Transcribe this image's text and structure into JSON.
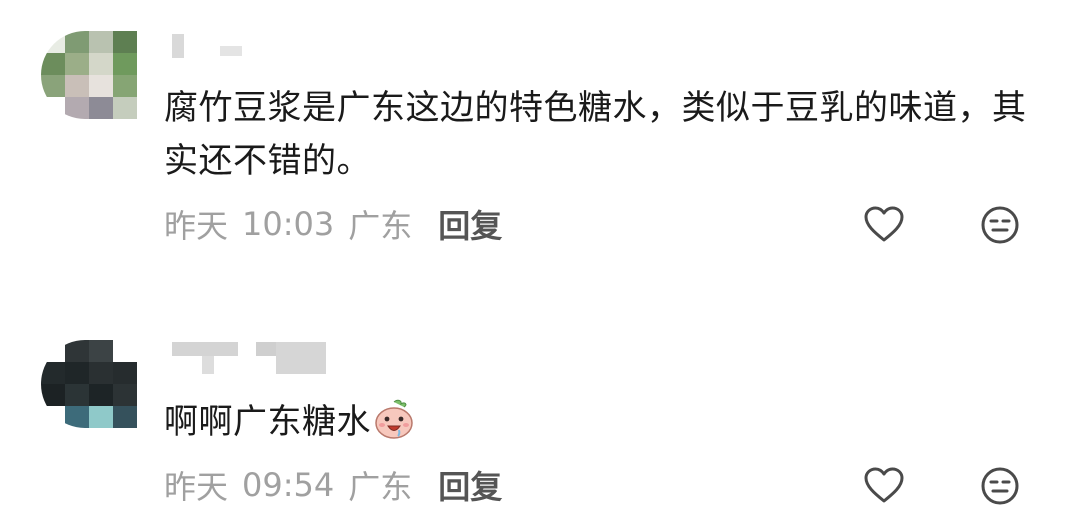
{
  "comments": [
    {
      "text": "腐竹豆浆是广东这边的特色糖水，类似于豆乳的味道，其实还不错的。",
      "date": "昨天",
      "time": "10:03",
      "location": "广东",
      "reply_label": "回复",
      "icons": {
        "like": "heart-outline-icon",
        "reaction": "neutral-face-icon"
      }
    },
    {
      "text": "啊啊广东糖水",
      "emoji": "drooling-bun-sticker-icon",
      "date": "昨天",
      "time": "09:54",
      "location": "广东",
      "reply_label": "回复",
      "icons": {
        "like": "heart-outline-icon",
        "reaction": "neutral-face-icon"
      }
    }
  ],
  "colors": {
    "text_primary": "#1a1a1a",
    "text_meta": "#a0a0a0",
    "reply": "#555555",
    "icon": "#4a4a4a"
  }
}
